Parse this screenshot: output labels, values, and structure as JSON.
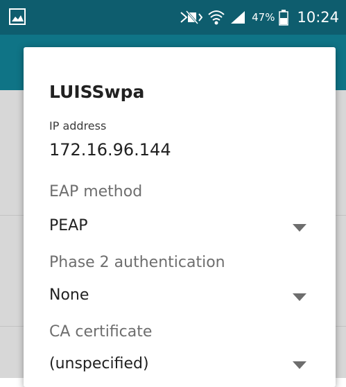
{
  "status_bar": {
    "icons": [
      "gallery-icon",
      "silent-mode-icon",
      "wifi-icon",
      "signal-icon",
      "battery-icon"
    ],
    "battery_percent": "47%",
    "time": "10:24"
  },
  "dialog": {
    "title": "LUISSwpa",
    "ip_label": "IP address",
    "ip_value": "172.16.96.144",
    "fields": [
      {
        "label": "EAP method",
        "value": "PEAP"
      },
      {
        "label": "Phase 2 authentication",
        "value": "None"
      },
      {
        "label": "CA certificate",
        "value": "(unspecified)"
      }
    ]
  },
  "colors": {
    "status_bar": "#0e5d6e",
    "action_bar": "#0f7486",
    "backdrop": "#d7d7d7",
    "dialog": "#ffffff"
  }
}
